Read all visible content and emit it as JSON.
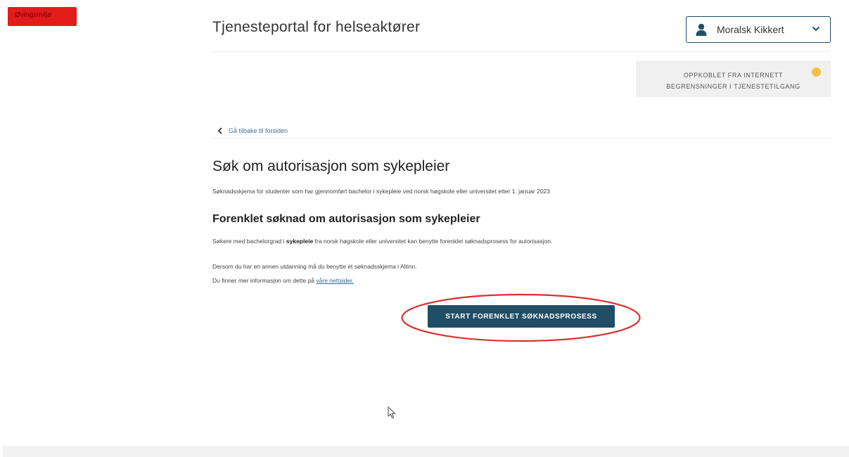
{
  "env_badge": {
    "label": "Øvingsmiljø"
  },
  "header": {
    "title": "Tjenesteportal for helseaktører",
    "user": {
      "name": "Moralsk Kikkert",
      "icon": "person-icon",
      "menu_icon": "chevron-down-icon"
    }
  },
  "status": {
    "line1": "OPPKOBLET FRA INTERNETT",
    "line2": "BEGRENSNINGER I TJENESTETILGANG",
    "indicator_color": "#f2c142"
  },
  "nav": {
    "back_label": "Gå tilbake til forsiden",
    "back_icon": "chevron-left-icon"
  },
  "main": {
    "title": "Søk om autorisasjon som sykepleier",
    "intro": "Søknadsskjema for studenter som har gjennomført bachelor i sykepleie ved norsk høgskole eller universitet etter 1. januar 2023",
    "section_title": "Forenklet søknad om autorisasjon som sykepleier",
    "para1_before": "Søkere med bachelorgrad i ",
    "para1_bold": "sykepleie",
    "para1_after": " fra norsk høgskole eller universitet kan benytte forenklet søknadsprosess for autorisasjon.",
    "para2": "Dersom du har en annen utdanning må du benytte et søknadsskjema i Altinn.",
    "para3_before": "Du finner mer informasjon om dette på ",
    "para3_link": "våre nettsider.",
    "start_button": "START FORENKLET SØKNADSPROSESS"
  },
  "colors": {
    "primary": "#1f4e66",
    "badge_red": "#e31b1b",
    "annotation_red": "#d9302c",
    "link": "#2a6a95"
  }
}
